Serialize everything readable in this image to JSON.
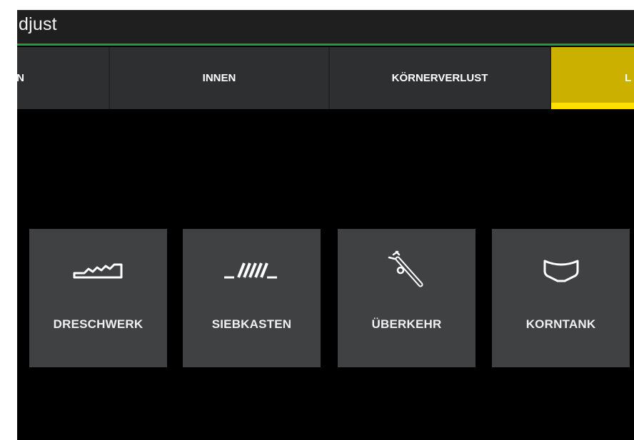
{
  "header": {
    "title": "djust"
  },
  "tabs": [
    {
      "label": "N",
      "active": false
    },
    {
      "label": "INNEN",
      "active": false
    },
    {
      "label": "KÖRNERVERLUST",
      "active": false
    },
    {
      "label": "L",
      "active": true
    }
  ],
  "tiles": [
    {
      "label": "DRESCHWERK",
      "icon": "threshing-drum-icon"
    },
    {
      "label": "SIEBKASTEN",
      "icon": "sieve-box-icon"
    },
    {
      "label": "ÜBERKEHR",
      "icon": "tailings-auger-icon"
    },
    {
      "label": "KORNTANK",
      "icon": "grain-tank-icon"
    }
  ],
  "colors": {
    "background": "#000000",
    "tab_bar": "#2e2f31",
    "tab_active": "#cbb000",
    "tab_active_indicator": "#ffe000",
    "tile": "#404142",
    "header_underline": "#1f9a45"
  }
}
